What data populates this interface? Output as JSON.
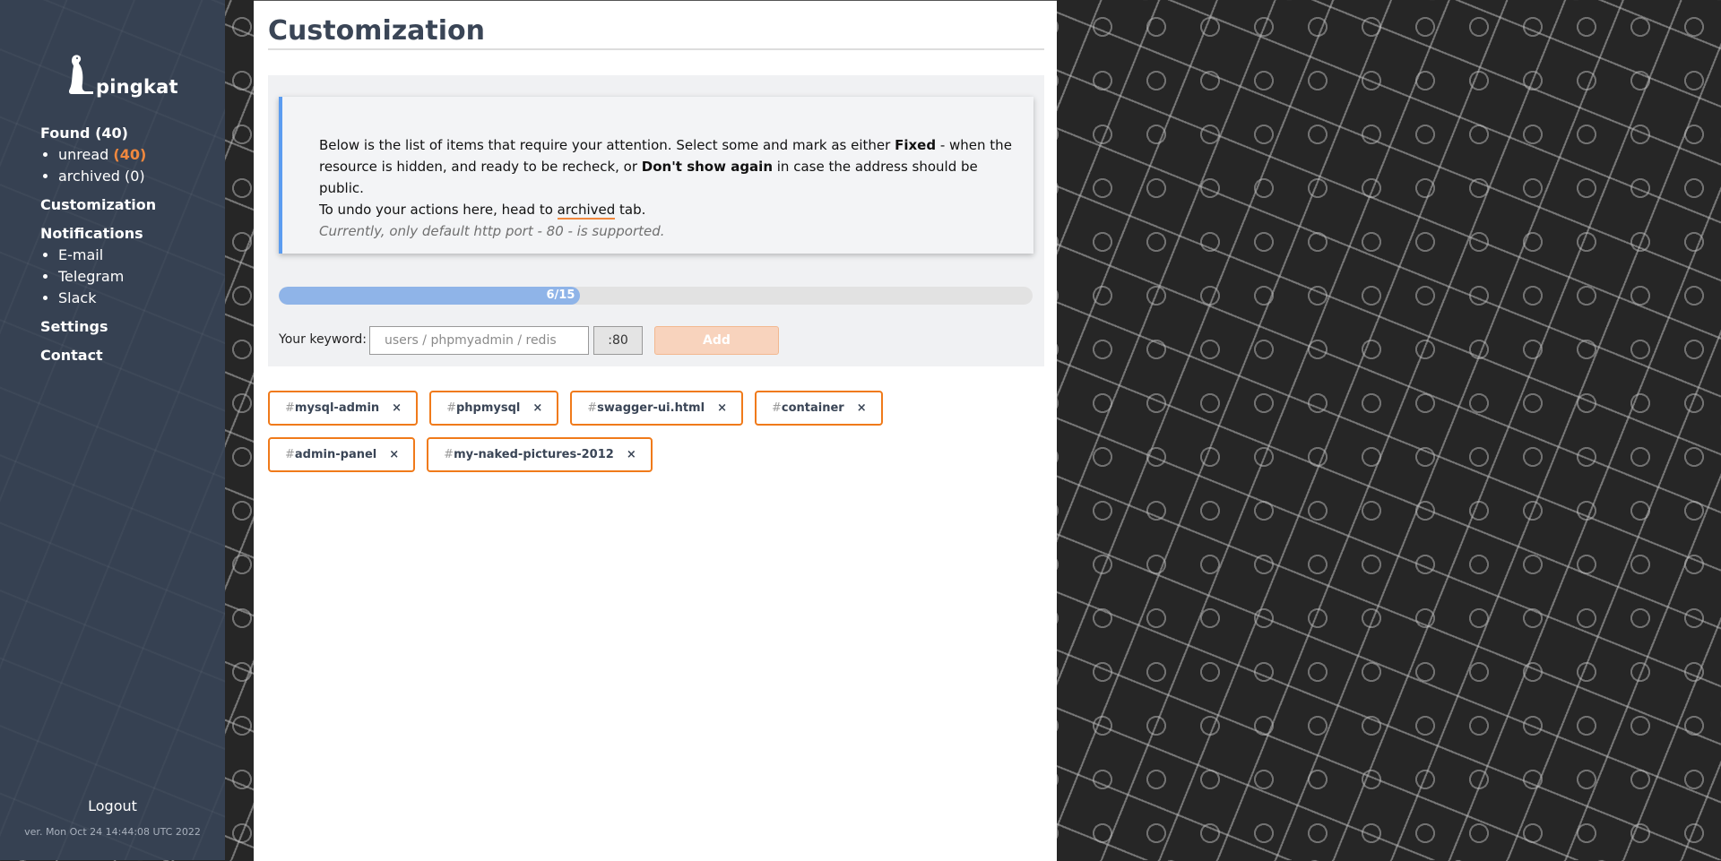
{
  "brand": {
    "name": "pingkat"
  },
  "sidebar": {
    "found": {
      "label": "Found",
      "count": "(40)"
    },
    "found_items": [
      {
        "label": "unread",
        "count": "(40)"
      },
      {
        "label": "archived",
        "count": "(0)"
      }
    ],
    "customization": "Customization",
    "notifications": "Notifications",
    "notification_items": [
      "E-mail",
      "Telegram",
      "Slack"
    ],
    "settings": "Settings",
    "contact": "Contact",
    "logout": "Logout",
    "version": "ver. Mon Oct 24 14:44:08 UTC 2022"
  },
  "main": {
    "title": "Customization",
    "notice": {
      "t1": "Below is the list of items that require your attention. Select some and mark as either ",
      "b1": "Fixed",
      "t2": " - when the resource is hidden, and ready to be recheck, or ",
      "b2": "Don't show again",
      "t3": " in case the address should be public.",
      "t4": "To undo your actions here, head to ",
      "link": "archived",
      "t5": " tab.",
      "note": "Currently, only default http port - 80 - is supported."
    },
    "progress": {
      "label": "6/15",
      "value": 6,
      "max": 15
    },
    "keyword": {
      "label": "Your keyword:",
      "value": "",
      "placeholder": "users / phpmyadmin / redis",
      "port": ":80",
      "add_label": "Add"
    },
    "tags": [
      {
        "hash": "#",
        "name": "mysql-admin",
        "remove": "×"
      },
      {
        "hash": "#",
        "name": "phpmysql",
        "remove": "×"
      },
      {
        "hash": "#",
        "name": "swagger-ui.html",
        "remove": "×"
      },
      {
        "hash": "#",
        "name": "container",
        "remove": "×"
      },
      {
        "hash": "#",
        "name": "admin-panel",
        "remove": "×"
      },
      {
        "hash": "#",
        "name": "my-naked-pictures-2012",
        "remove": "×"
      }
    ]
  },
  "colors": {
    "accent": "#f07a1a",
    "sidebar_bg": "#364152",
    "progress_fill": "#8fb4e8",
    "notice_border": "#5b9cf0"
  },
  "icons": {
    "logo": "meerkat-logo-icon",
    "tag_remove": "close-icon"
  }
}
